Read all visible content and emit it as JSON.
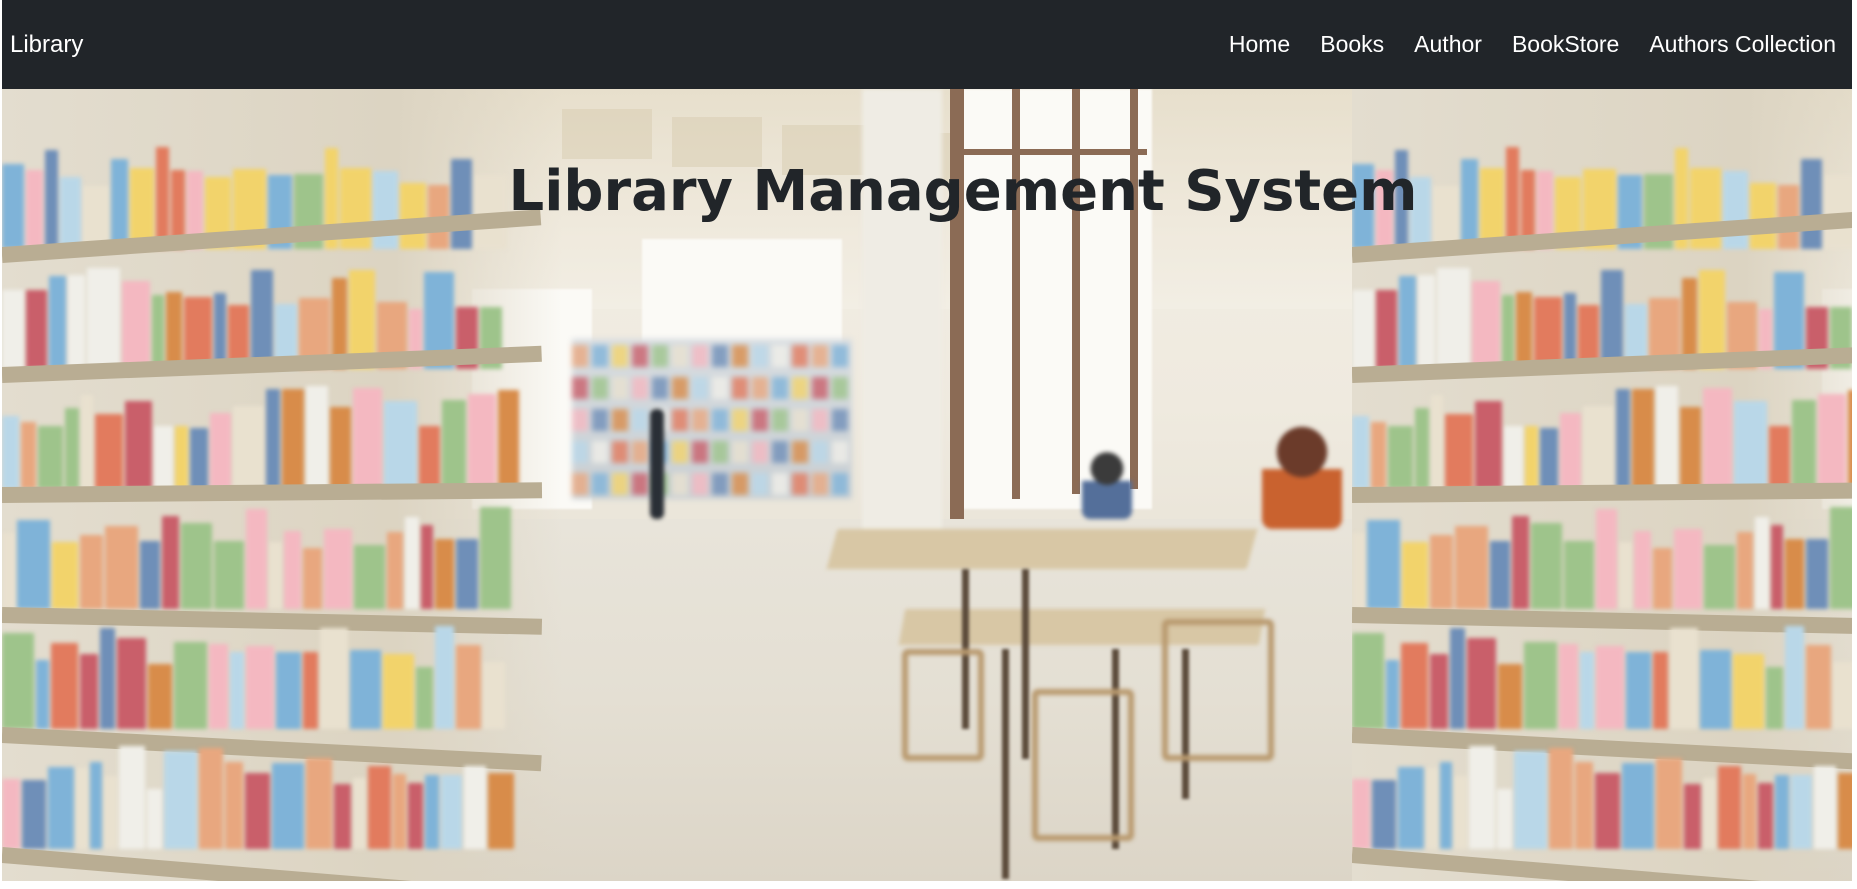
{
  "navbar": {
    "brand": "Library",
    "links": [
      "Home",
      "Books",
      "Author",
      "BookStore",
      "Authors Collection"
    ]
  },
  "hero": {
    "title": "Library Management System",
    "background_image": "library-interior-photo"
  },
  "colors": {
    "navbar_bg": "#212529",
    "nav_text": "#ffffff",
    "title_text": "#212529"
  }
}
